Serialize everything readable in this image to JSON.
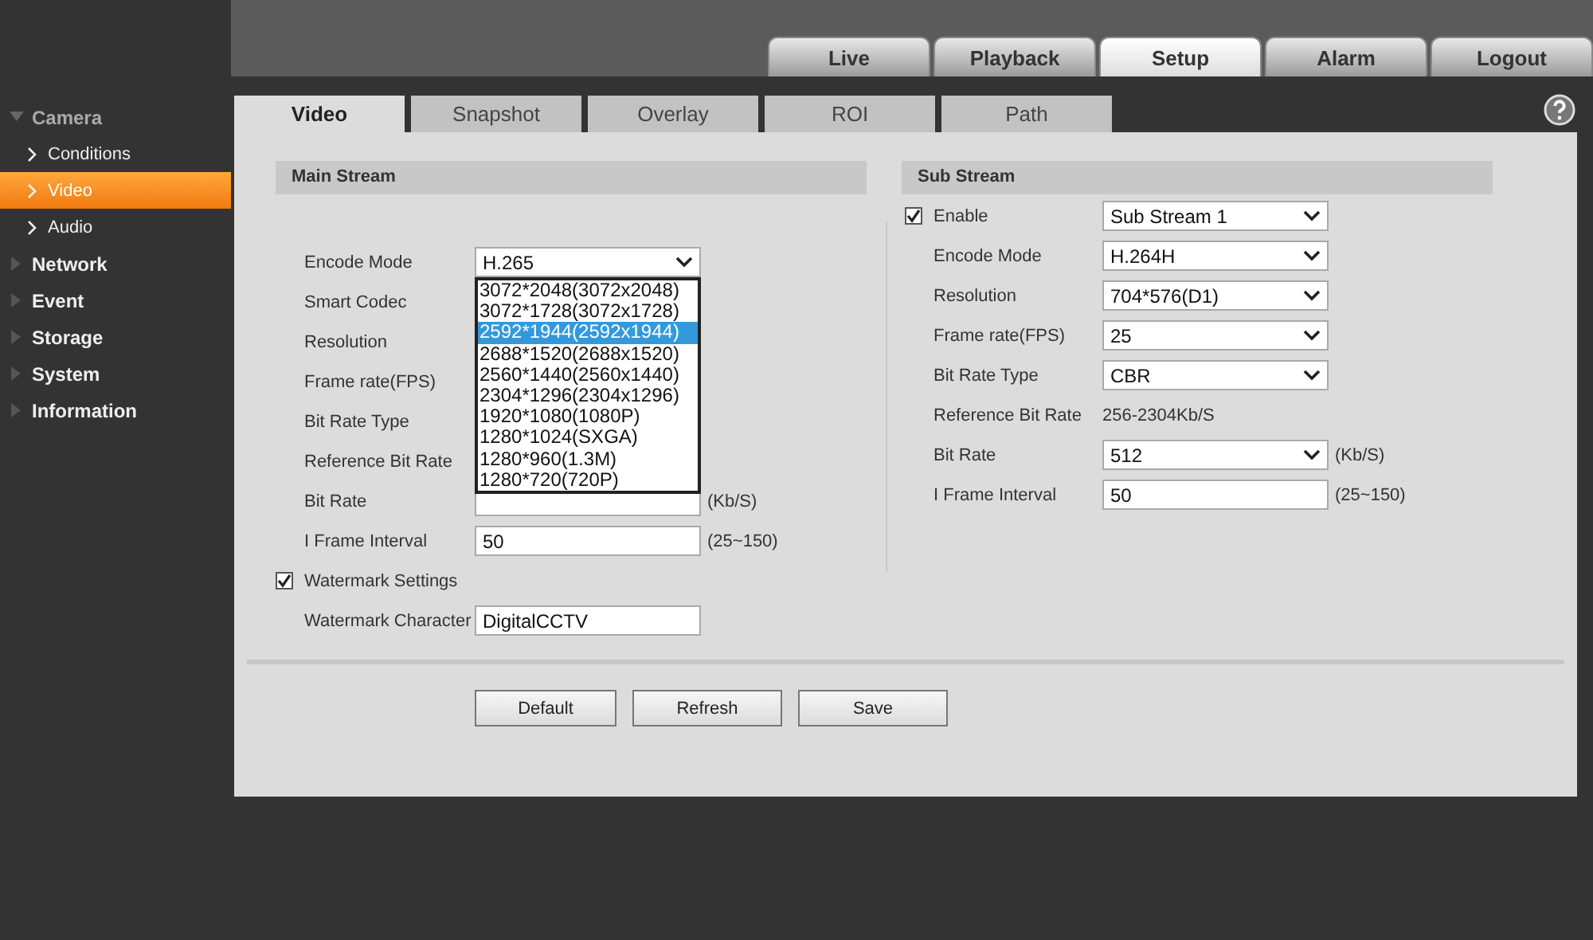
{
  "top_tabs": [
    {
      "label": "Live",
      "selected": false
    },
    {
      "label": "Playback",
      "selected": false
    },
    {
      "label": "Setup",
      "selected": true
    },
    {
      "label": "Alarm",
      "selected": false
    },
    {
      "label": "Logout",
      "selected": false
    }
  ],
  "sidebar": {
    "items": [
      {
        "label": "Camera",
        "expanded": true,
        "children": [
          {
            "label": "Conditions",
            "selected": false
          },
          {
            "label": "Video",
            "selected": true
          },
          {
            "label": "Audio",
            "selected": false
          }
        ]
      },
      {
        "label": "Network",
        "expanded": false
      },
      {
        "label": "Event",
        "expanded": false
      },
      {
        "label": "Storage",
        "expanded": false
      },
      {
        "label": "System",
        "expanded": false
      },
      {
        "label": "Information",
        "expanded": false
      }
    ]
  },
  "sub_tabs": [
    {
      "label": "Video",
      "selected": true
    },
    {
      "label": "Snapshot",
      "selected": false
    },
    {
      "label": "Overlay",
      "selected": false
    },
    {
      "label": "ROI",
      "selected": false
    },
    {
      "label": "Path",
      "selected": false
    }
  ],
  "main_stream": {
    "title": "Main Stream",
    "rows": [
      {
        "kind": "select",
        "label": "Encode Mode",
        "value": "H.265"
      },
      {
        "kind": "covered",
        "label": "Smart Codec"
      },
      {
        "kind": "covered",
        "label": "Resolution"
      },
      {
        "kind": "covered",
        "label": "Frame rate(FPS)"
      },
      {
        "kind": "covered",
        "label": "Bit Rate Type"
      },
      {
        "kind": "covered",
        "label": "Reference Bit Rate"
      },
      {
        "kind": "covered",
        "label": "Bit Rate",
        "unit": "(Kb/S)"
      },
      {
        "kind": "input",
        "label": "I Frame Interval",
        "value": "50",
        "unit": "(25~150)"
      },
      {
        "kind": "checkbox",
        "label": "Watermark Settings",
        "checked": true
      },
      {
        "kind": "input",
        "label": "Watermark Character",
        "value": "DigitalCCTV"
      }
    ],
    "dropdown": {
      "options": [
        {
          "label": "3072*2048(3072x2048)",
          "selected": false
        },
        {
          "label": "3072*1728(3072x1728)",
          "selected": false
        },
        {
          "label": "2592*1944(2592x1944)",
          "selected": true
        },
        {
          "label": "2688*1520(2688x1520)",
          "selected": false
        },
        {
          "label": "2560*1440(2560x1440)",
          "selected": false
        },
        {
          "label": "2304*1296(2304x1296)",
          "selected": false
        },
        {
          "label": "1920*1080(1080P)",
          "selected": false
        },
        {
          "label": "1280*1024(SXGA)",
          "selected": false
        },
        {
          "label": "1280*960(1.3M)",
          "selected": false
        },
        {
          "label": "1280*720(720P)",
          "selected": false
        }
      ]
    }
  },
  "sub_stream": {
    "title": "Sub Stream",
    "rows": [
      {
        "kind": "checkbox-select",
        "label": "Enable",
        "checked": true,
        "value": "Sub Stream 1"
      },
      {
        "kind": "select",
        "label": "Encode Mode",
        "value": "H.264H"
      },
      {
        "kind": "select",
        "label": "Resolution",
        "value": "704*576(D1)"
      },
      {
        "kind": "select",
        "label": "Frame rate(FPS)",
        "value": "25"
      },
      {
        "kind": "select",
        "label": "Bit Rate Type",
        "value": "CBR"
      },
      {
        "kind": "text",
        "label": "Reference Bit Rate",
        "value": "256-2304Kb/S"
      },
      {
        "kind": "select",
        "label": "Bit Rate",
        "value": "512",
        "unit": "(Kb/S)"
      },
      {
        "kind": "input",
        "label": "I Frame Interval",
        "value": "50",
        "unit": "(25~150)"
      }
    ]
  },
  "buttons": [
    "Default",
    "Refresh",
    "Save"
  ]
}
